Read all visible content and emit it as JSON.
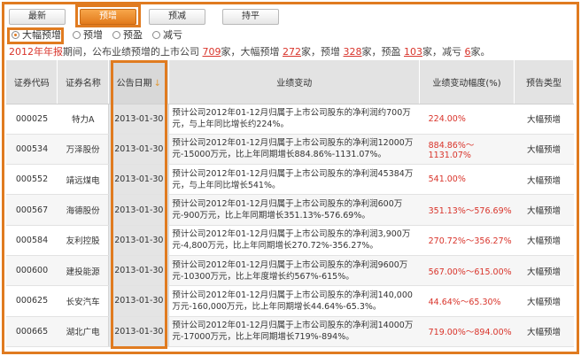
{
  "tabs": [
    {
      "label": "最新"
    },
    {
      "label": "预增"
    },
    {
      "label": "预减"
    },
    {
      "label": "持平"
    }
  ],
  "radios": [
    {
      "label": "大幅预增",
      "checked": true
    },
    {
      "label": "预增",
      "checked": false
    },
    {
      "label": "预盈",
      "checked": false
    },
    {
      "label": "减亏",
      "checked": false
    }
  ],
  "summary": {
    "year": "2012年",
    "year_report": "年报",
    "text1": "期间，公布业绩预增的上市公司",
    "total": "709",
    "unit1": "家，大幅预增",
    "big_up": "272",
    "unit2": "家，预增",
    "up": "328",
    "unit3": "家，预盈",
    "profit": "103",
    "unit4": "家，减亏",
    "less_loss": "6",
    "unit5": "家。"
  },
  "table": {
    "headers": [
      "证券代码",
      "证券名称",
      "公告日期",
      "业绩变动",
      "业绩变动幅度(%)",
      "预告类型"
    ],
    "rows": [
      {
        "code": "000025",
        "name": "特力A",
        "date": "2013-01-30",
        "detail": "预计公司2012年01-12月归属于上市公司股东的净利润约700万元，与上年同比增长约224%。",
        "range": "224.00%",
        "type": "大幅预增"
      },
      {
        "code": "000534",
        "name": "万泽股份",
        "date": "2013-01-30",
        "detail": "预计公司2012年01-12月归属于上市公司股东的净利润12000万元-15000万元，比上年同期增长884.86%-1131.07%。",
        "range": "884.86%～1131.07%",
        "type": "大幅预增"
      },
      {
        "code": "000552",
        "name": "靖远煤电",
        "date": "2013-01-30",
        "detail": "预计公司2012年01-12月归属于上市公司股东的净利润45384万元，与上年同比增长541%。",
        "range": "541.00%",
        "type": "大幅预增"
      },
      {
        "code": "000567",
        "name": "海德股份",
        "date": "2013-01-30",
        "detail": "预计公司2012年01-12月归属于上市公司股东的净利润600万元-900万元，比上年同期增长351.13%-576.69%。",
        "range": "351.13%～576.69%",
        "type": "大幅预增"
      },
      {
        "code": "000584",
        "name": "友利控股",
        "date": "2013-01-30",
        "detail": "预计公司2012年01-12月归属于上市公司股东的净利润3,900万元-4,800万元，比上年同期增长270.72%-356.27%。",
        "range": "270.72%～356.27%",
        "type": "大幅预增"
      },
      {
        "code": "000600",
        "name": "建投能源",
        "date": "2013-01-30",
        "detail": "预计公司2012年01-12月归属于上市公司股东的净利润9600万元-10300万元，比上年度增长约567%-615%。",
        "range": "567.00%～615.00%",
        "type": "大幅预增"
      },
      {
        "code": "000625",
        "name": "长安汽车",
        "date": "2013-01-30",
        "detail": "预计公司2012年01-12月归属于上市公司股东的净利润140,000万元-160,000万元，比上年同期增长44.64%-65.3%。",
        "range": "44.64%～65.30%",
        "type": "大幅预增"
      },
      {
        "code": "000665",
        "name": "湖北广电",
        "date": "2013-01-30",
        "detail": "预计公司2012年01-12月归属于上市公司股东的净利润14000万元-17000万元，比上年同期增长719%-894%。",
        "range": "719.00%～894.00%",
        "type": "大幅预增"
      }
    ]
  },
  "colors": {
    "accent": "#e07b20",
    "red": "#d9342b",
    "link": "#245d9e"
  },
  "icons": {
    "sort": "sort-down-arrow-icon"
  }
}
